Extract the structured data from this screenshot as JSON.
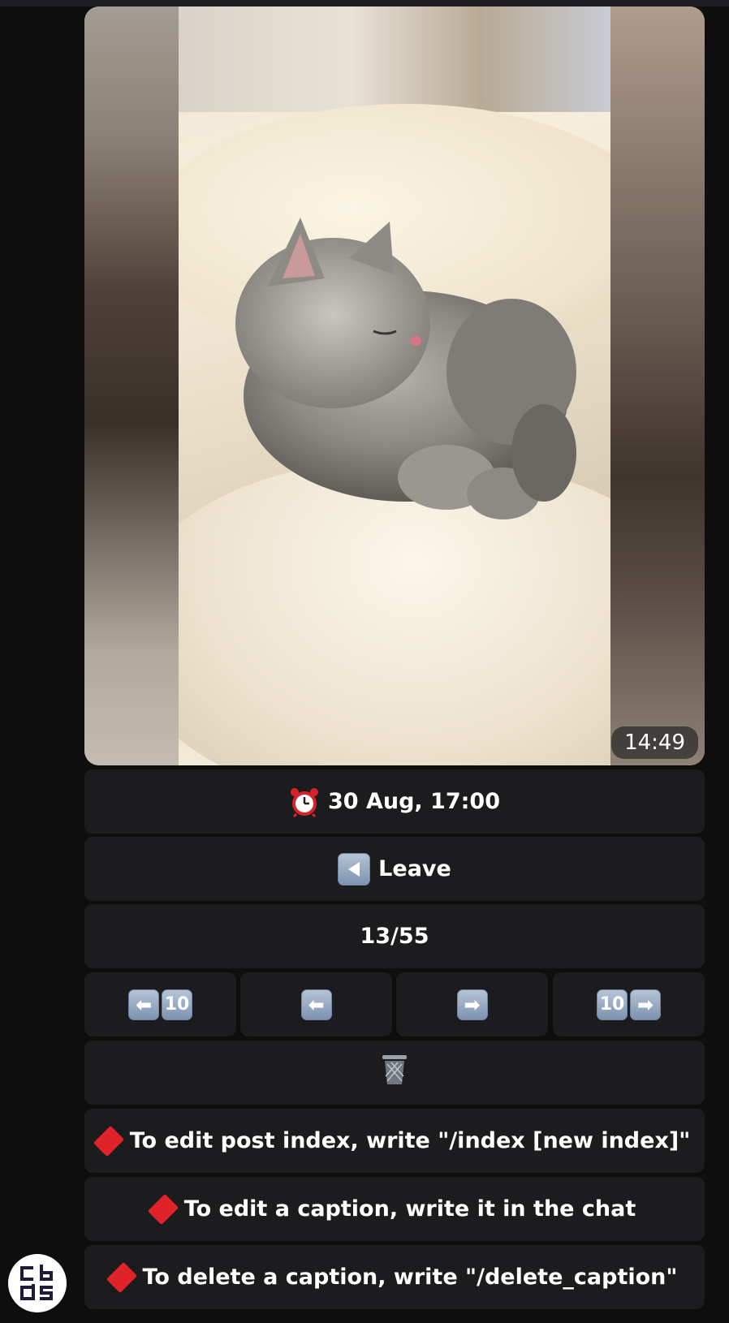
{
  "media": {
    "timestamp": "14:49",
    "image_subject": "sleeping-gray-kitten-on-cream-knit-blanket"
  },
  "buttons": {
    "schedule": {
      "icon": "alarm-clock-icon",
      "label": "30 Aug, 17:00"
    },
    "leave": {
      "icon": "back-arrow-icon",
      "label": "Leave"
    },
    "counter": {
      "label": "13/55"
    },
    "nav": [
      {
        "name": "back-10",
        "keys": [
          "⬅",
          "10"
        ]
      },
      {
        "name": "back-1",
        "keys": [
          "⬅"
        ]
      },
      {
        "name": "forward-1",
        "keys": [
          "➡"
        ]
      },
      {
        "name": "forward-10",
        "keys": [
          "10",
          "➡"
        ]
      }
    ],
    "delete": {
      "icon": "wastebasket-icon"
    },
    "hint_index": {
      "icon": "red-diamond-icon",
      "label": "To edit post index, write \"/index [new index]\""
    },
    "hint_caption": {
      "icon": "red-diamond-icon",
      "label": "To edit a caption, write it in the chat"
    },
    "hint_delete_caption": {
      "icon": "red-diamond-icon",
      "label": "To delete a caption, write \"/delete_caption\""
    }
  },
  "colors": {
    "background": "#0e0e0f",
    "button": "#1c1c1e",
    "diamond": "#e0222b",
    "key": "#7d93b0"
  },
  "avatar": {
    "logo_text": "cb ds"
  }
}
